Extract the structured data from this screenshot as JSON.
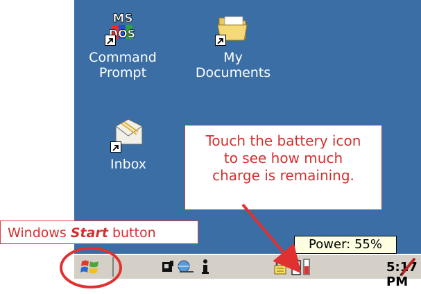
{
  "desktop": {
    "icons": [
      {
        "label_line1": "Command",
        "label_line2": "Prompt",
        "icon": "ms-dos-icon"
      },
      {
        "label_line1": "My",
        "label_line2": "Documents",
        "icon": "folder-icon"
      },
      {
        "label_line1": "Inbox",
        "icon": "inbox-icon"
      }
    ],
    "background_color": "#3a6ea5"
  },
  "callouts": {
    "battery": {
      "line1": "Touch the battery icon",
      "line2": "to see how much",
      "line3": "charge is remaining."
    },
    "start": {
      "prefix": "Windows ",
      "emphasis": "Start",
      "suffix": " button"
    },
    "color": "#d32f2f"
  },
  "tooltip": {
    "text": "Power: 55%"
  },
  "taskbar": {
    "clock": "5:17 PM",
    "tray_icons": [
      "signal-icon",
      "network-icon",
      "info-icon",
      "lock-icon",
      "battery-icon",
      "battery-meter-icon",
      "pen-icon"
    ],
    "start_icon": "windows-logo-icon",
    "battery_level": 0.55
  }
}
